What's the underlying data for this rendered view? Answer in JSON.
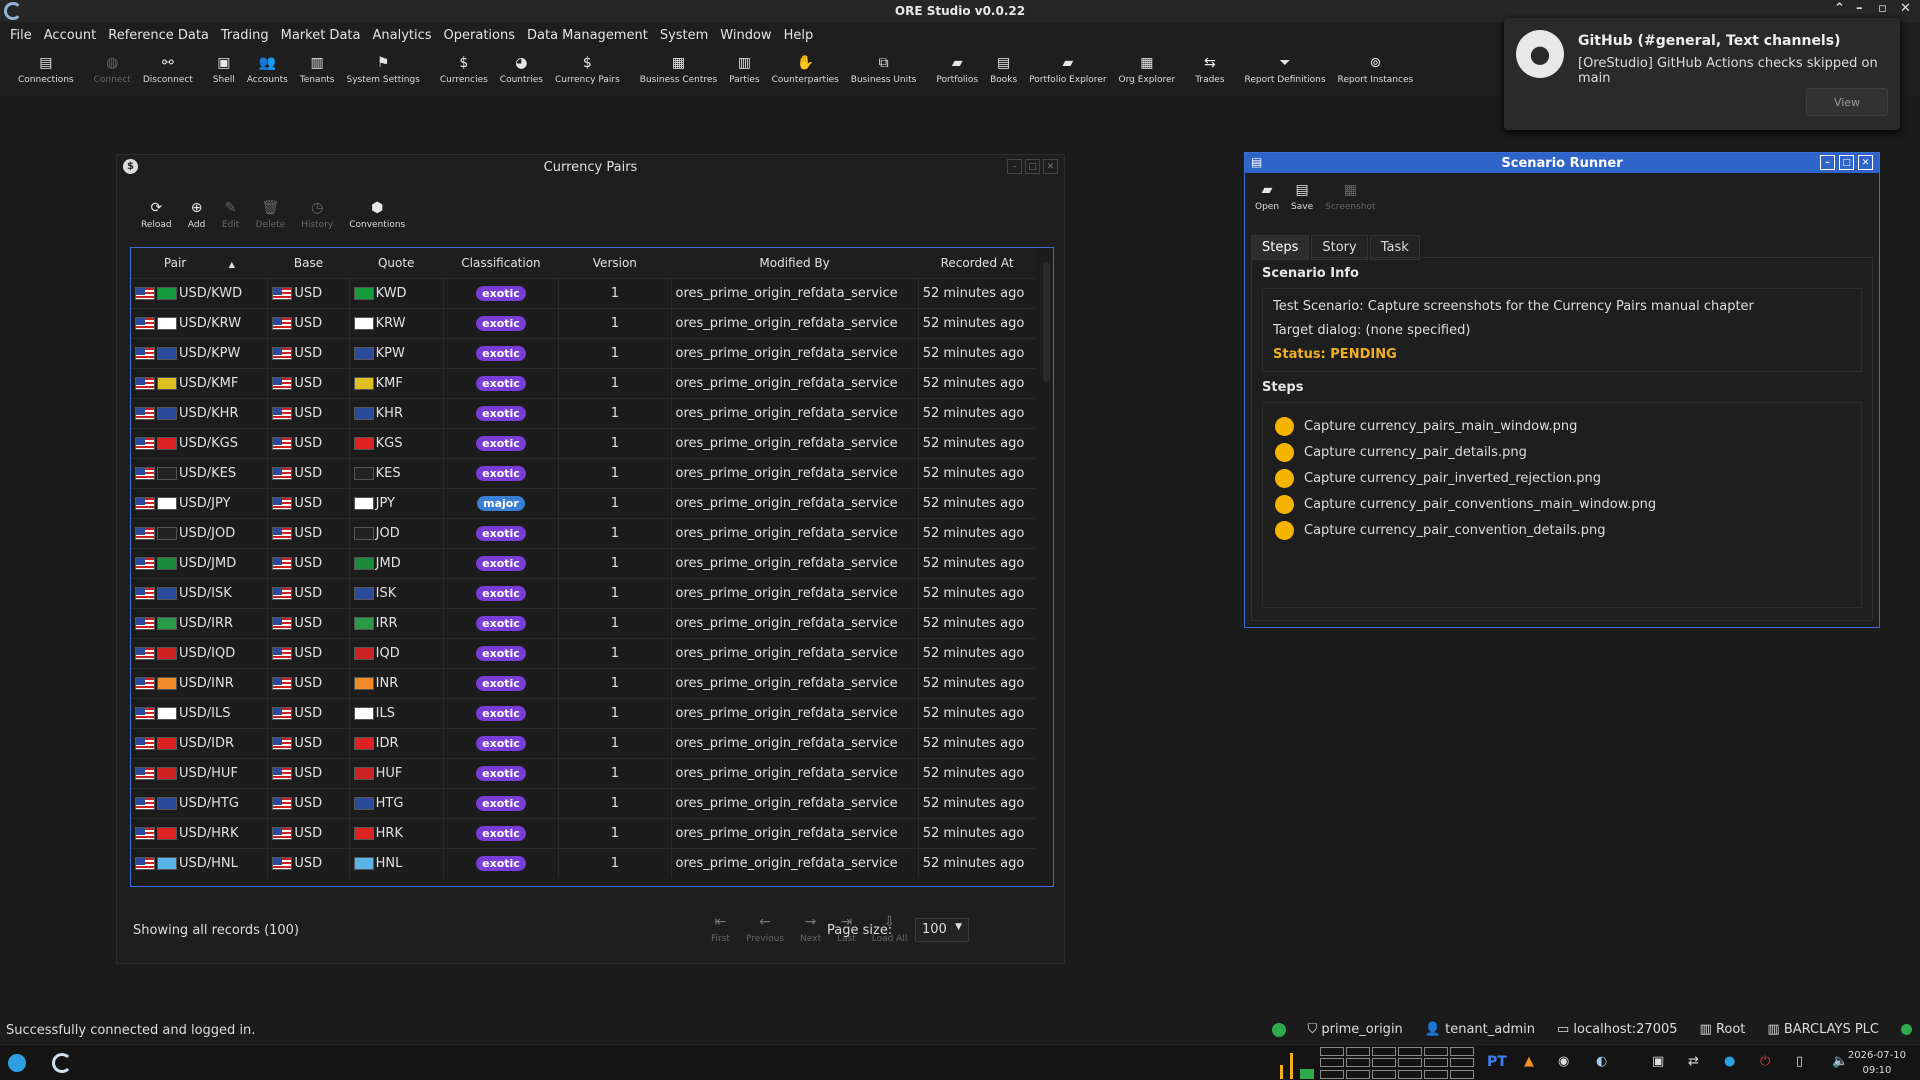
{
  "app": {
    "title": "ORE Studio v0.0.22"
  },
  "menu": [
    "File",
    "Account",
    "Reference Data",
    "Trading",
    "Market Data",
    "Analytics",
    "Operations",
    "Data Management",
    "System",
    "Window",
    "Help"
  ],
  "toolbar": [
    {
      "label": "Connections",
      "icon": "connections-icon",
      "enabled": true
    },
    {
      "label": "Connect",
      "icon": "connect-icon",
      "enabled": false
    },
    {
      "label": "Disconnect",
      "icon": "disconnect-icon",
      "enabled": true
    },
    {
      "label": "Shell",
      "icon": "shell-icon",
      "enabled": true
    },
    {
      "label": "Accounts",
      "icon": "accounts-icon",
      "enabled": true
    },
    {
      "label": "Tenants",
      "icon": "tenants-icon",
      "enabled": true
    },
    {
      "label": "System Settings",
      "icon": "flag-icon",
      "enabled": true
    },
    {
      "label": "Currencies",
      "icon": "currency-icon",
      "enabled": true
    },
    {
      "label": "Countries",
      "icon": "globe-icon",
      "enabled": true
    },
    {
      "label": "Currency Pairs",
      "icon": "currency-pair-icon",
      "enabled": true
    },
    {
      "label": "Business Centres",
      "icon": "building-icon",
      "enabled": true
    },
    {
      "label": "Parties",
      "icon": "parties-icon",
      "enabled": true
    },
    {
      "label": "Counterparties",
      "icon": "handshake-icon",
      "enabled": true
    },
    {
      "label": "Business Units",
      "icon": "org-icon",
      "enabled": true
    },
    {
      "label": "Portfolios",
      "icon": "briefcase-icon",
      "enabled": true
    },
    {
      "label": "Books",
      "icon": "book-icon",
      "enabled": true
    },
    {
      "label": "Portfolio Explorer",
      "icon": "portfolio-explorer-icon",
      "enabled": true
    },
    {
      "label": "Org Explorer",
      "icon": "org-explorer-icon",
      "enabled": true
    },
    {
      "label": "Trades",
      "icon": "trades-icon",
      "enabled": true
    },
    {
      "label": "Report Definitions",
      "icon": "report-definition-icon",
      "enabled": true
    },
    {
      "label": "Report Instances",
      "icon": "report-instance-icon",
      "enabled": true
    }
  ],
  "notification": {
    "title": "GitHub (#general, Text channels)",
    "body": "[OreStudio] GitHub Actions checks skipped on main",
    "button": "View"
  },
  "currency_pairs": {
    "title": "Currency Pairs",
    "tools": [
      {
        "label": "Reload",
        "enabled": true
      },
      {
        "label": "Add",
        "enabled": true
      },
      {
        "label": "Edit",
        "enabled": false
      },
      {
        "label": "Delete",
        "enabled": false
      },
      {
        "label": "History",
        "enabled": false
      },
      {
        "label": "Conventions",
        "enabled": true
      }
    ],
    "columns": [
      "Pair",
      "Base",
      "Quote",
      "Classification",
      "Version",
      "Modified By",
      "Recorded At"
    ],
    "rows": [
      [
        "USD/KWD",
        "USD",
        "KWD",
        "exotic",
        "1",
        "ores_prime_origin_refdata_service",
        "52 minutes ago"
      ],
      [
        "USD/KRW",
        "USD",
        "KRW",
        "exotic",
        "1",
        "ores_prime_origin_refdata_service",
        "52 minutes ago"
      ],
      [
        "USD/KPW",
        "USD",
        "KPW",
        "exotic",
        "1",
        "ores_prime_origin_refdata_service",
        "52 minutes ago"
      ],
      [
        "USD/KMF",
        "USD",
        "KMF",
        "exotic",
        "1",
        "ores_prime_origin_refdata_service",
        "52 minutes ago"
      ],
      [
        "USD/KHR",
        "USD",
        "KHR",
        "exotic",
        "1",
        "ores_prime_origin_refdata_service",
        "52 minutes ago"
      ],
      [
        "USD/KGS",
        "USD",
        "KGS",
        "exotic",
        "1",
        "ores_prime_origin_refdata_service",
        "52 minutes ago"
      ],
      [
        "USD/KES",
        "USD",
        "KES",
        "exotic",
        "1",
        "ores_prime_origin_refdata_service",
        "52 minutes ago"
      ],
      [
        "USD/JPY",
        "USD",
        "JPY",
        "major",
        "1",
        "ores_prime_origin_refdata_service",
        "52 minutes ago"
      ],
      [
        "USD/JOD",
        "USD",
        "JOD",
        "exotic",
        "1",
        "ores_prime_origin_refdata_service",
        "52 minutes ago"
      ],
      [
        "USD/JMD",
        "USD",
        "JMD",
        "exotic",
        "1",
        "ores_prime_origin_refdata_service",
        "52 minutes ago"
      ],
      [
        "USD/ISK",
        "USD",
        "ISK",
        "exotic",
        "1",
        "ores_prime_origin_refdata_service",
        "52 minutes ago"
      ],
      [
        "USD/IRR",
        "USD",
        "IRR",
        "exotic",
        "1",
        "ores_prime_origin_refdata_service",
        "52 minutes ago"
      ],
      [
        "USD/IQD",
        "USD",
        "IQD",
        "exotic",
        "1",
        "ores_prime_origin_refdata_service",
        "52 minutes ago"
      ],
      [
        "USD/INR",
        "USD",
        "INR",
        "exotic",
        "1",
        "ores_prime_origin_refdata_service",
        "52 minutes ago"
      ],
      [
        "USD/ILS",
        "USD",
        "ILS",
        "exotic",
        "1",
        "ores_prime_origin_refdata_service",
        "52 minutes ago"
      ],
      [
        "USD/IDR",
        "USD",
        "IDR",
        "exotic",
        "1",
        "ores_prime_origin_refdata_service",
        "52 minutes ago"
      ],
      [
        "USD/HUF",
        "USD",
        "HUF",
        "exotic",
        "1",
        "ores_prime_origin_refdata_service",
        "52 minutes ago"
      ],
      [
        "USD/HTG",
        "USD",
        "HTG",
        "exotic",
        "1",
        "ores_prime_origin_refdata_service",
        "52 minutes ago"
      ],
      [
        "USD/HRK",
        "USD",
        "HRK",
        "exotic",
        "1",
        "ores_prime_origin_refdata_service",
        "52 minutes ago"
      ],
      [
        "USD/HNL",
        "USD",
        "HNL",
        "exotic",
        "1",
        "ores_prime_origin_refdata_service",
        "52 minutes ago"
      ]
    ],
    "footer": {
      "count": "Showing all records (100)",
      "nav": [
        "First",
        "Previous",
        "Next",
        "Last",
        "Load All"
      ],
      "page_size_label": "Page size:",
      "page_size": "100"
    },
    "colors": {
      "exotic": "#7a3cd6",
      "major": "#3a7fd6"
    }
  },
  "scenario": {
    "title": "Scenario Runner",
    "tools": [
      {
        "label": "Open",
        "enabled": true
      },
      {
        "label": "Save",
        "enabled": true
      },
      {
        "label": "Screenshot",
        "enabled": false
      }
    ],
    "tabs": [
      "Steps",
      "Story",
      "Task"
    ],
    "info_heading": "Scenario Info",
    "test": "Test Scenario: Capture screenshots for the Currency Pairs manual chapter",
    "target": "Target dialog: (none specified)",
    "status": "Status: PENDING",
    "steps_heading": "Steps",
    "steps": [
      "Capture currency_pairs_main_window.png",
      "Capture currency_pair_details.png",
      "Capture currency_pair_inverted_rejection.png",
      "Capture currency_pair_conventions_main_window.png",
      "Capture currency_pair_convention_details.png"
    ]
  },
  "status": {
    "message": "Successfully connected and logged in.",
    "tenant": "prime_origin",
    "user": "tenant_admin",
    "host": "localhost:27005",
    "root": "Root",
    "party": "BARCLAYS PLC"
  },
  "taskbar": {
    "lang": "PT",
    "date": "2026-07-10",
    "time": "09:10"
  }
}
